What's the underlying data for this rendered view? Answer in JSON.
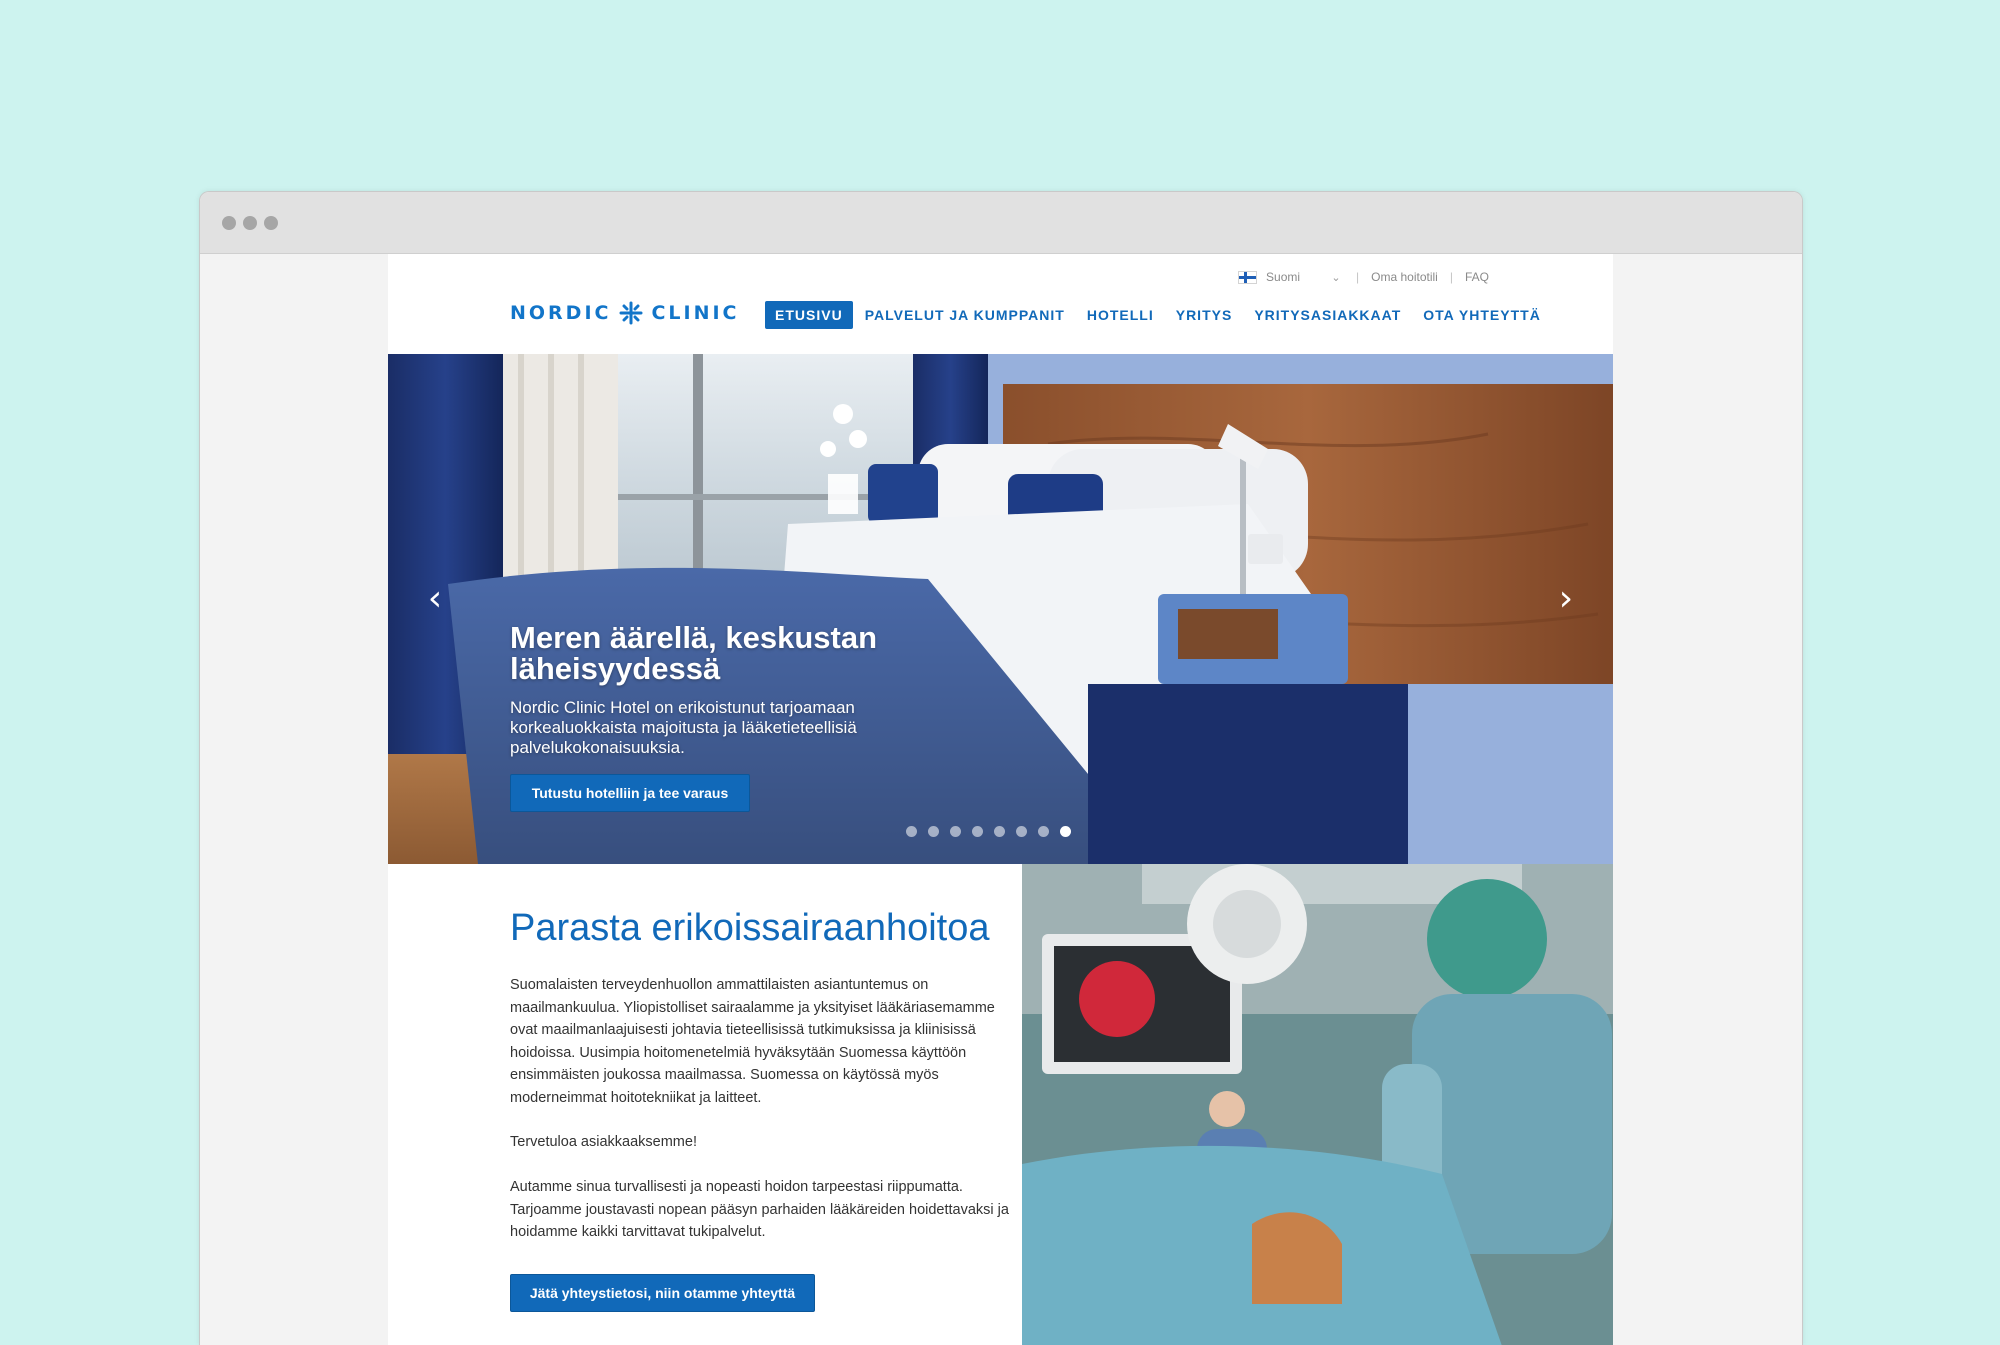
{
  "browser": {
    "window_dots": [
      "close",
      "minimize",
      "maximize"
    ]
  },
  "header": {
    "logo": {
      "left": "NORDIC",
      "right": "CLINIC",
      "icon": "snowflake-cross-icon"
    },
    "utility": {
      "language": "Suomi",
      "language_flag": "finland-flag-icon",
      "account_link": "Oma hoitotili",
      "faq_link": "FAQ",
      "separator": "|"
    },
    "nav": [
      {
        "label": "ETUSIVU",
        "active": true
      },
      {
        "label": "PALVELUT JA KUMPPANIT",
        "active": false
      },
      {
        "label": "HOTELLI",
        "active": false
      },
      {
        "label": "YRITYS",
        "active": false
      },
      {
        "label": "YRITYSASIAKKAAT",
        "active": false
      },
      {
        "label": "OTA YHTEYTTÄ",
        "active": false
      }
    ]
  },
  "hero": {
    "title": "Meren äärellä, keskustan läheisyydessä",
    "description": "Nordic Clinic Hotel on erikoistunut tarjoamaan korkealuokkaista majoitusta ja lääketieteellisiä palvelukokonaisuuksia.",
    "cta": "Tutustu hotelliin ja tee varaus",
    "prev_icon": "chevron-left-icon",
    "next_icon": "chevron-right-icon",
    "slide_count": 8,
    "active_slide": 8
  },
  "main": {
    "heading": "Parasta erikoissairaanhoitoa",
    "paragraphs": [
      "Suomalaisten terveydenhuollon ammattilaisten asiantuntemus on maailmankuulua. Yliopistolliset sairaalamme ja yksityiset lääkäriasemamme ovat maailmanlaajuisesti johtavia tieteellisissä tutkimuksissa ja kliinisissä hoidoissa. Uusimpia hoitomenetelmiä hyväksytään Suomessa käyttöön ensimmäisten joukossa maailmassa. Suomessa on käytössä myös moderneimmat hoitotekniikat ja laitteet.",
      "Tervetuloa asiakkaaksemme!",
      "Autamme sinua turvallisesti ja nopeasti hoidon tarpeestasi riippumatta. Tarjoamme joustavasti nopean pääsyn parhaiden lääkäreiden hoidettavaksi ja hoidamme kaikki tarvittavat tukipalvelut."
    ],
    "cta": "Jätä yhteystietosi, niin otamme yhteyttä"
  },
  "colors": {
    "background": "#cdf3ef",
    "brand_blue": "#1169b9",
    "browser_bar": "#e1e1e1"
  }
}
